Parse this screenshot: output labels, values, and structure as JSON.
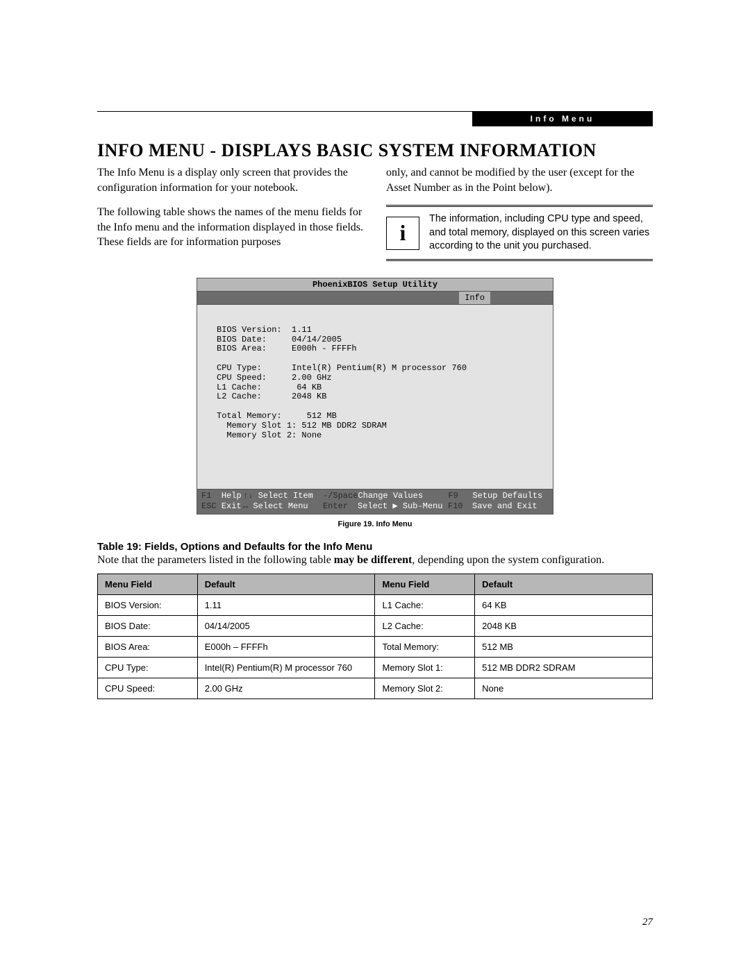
{
  "header": {
    "tab": "Info Menu"
  },
  "title": "INFO MENU - DISPLAYS BASIC SYSTEM INFORMATION",
  "body": {
    "p1": "The Info Menu is a display only screen that provides the configuration information for your notebook.",
    "p2": "The following table shows the names of the menu fields for the Info menu and the information displayed in those fields. These fields are for information purposes",
    "p3": "only, and cannot be modified by the user (except for the Asset Number as in the Point below).",
    "note": "The information, including CPU type and speed, and total memory, displayed on this screen varies according to the unit you purchased."
  },
  "bios": {
    "util_title": "PhoenixBIOS Setup Utility",
    "tab": "Info",
    "fields": [
      {
        "label": "BIOS Version:",
        "value": "1.11"
      },
      {
        "label": "BIOS Date:",
        "value": "04/14/2005"
      },
      {
        "label": "BIOS Area:",
        "value": "E000h - FFFFh"
      }
    ],
    "group2": [
      {
        "label": "CPU Type:",
        "value": "Intel(R) Pentium(R) M processor 760"
      },
      {
        "label": "CPU Speed:",
        "value": "2.00 GHz"
      },
      {
        "label": "L1 Cache:",
        "value": " 64 KB"
      },
      {
        "label": "L2 Cache:",
        "value": "2048 KB"
      }
    ],
    "group3": [
      {
        "label": "Total Memory:",
        "value": " 512 MB"
      },
      {
        "label": "  Memory Slot 1:",
        "value": "512 MB DDR2 SDRAM"
      },
      {
        "label": "  Memory Slot 2:",
        "value": "None"
      }
    ],
    "footer": {
      "r1": {
        "k1": "F1",
        "t1": "Help",
        "a1": "↑↓",
        "t2": "Select Item",
        "k2": "-/Space",
        "t3": "Change Values",
        "k3": "F9",
        "t4": "Setup Defaults"
      },
      "r2": {
        "k1": "ESC",
        "t1": "Exit",
        "a1": "↔",
        "t2": "Select Menu",
        "k2": "Enter",
        "t3": "Select ▶ Sub-Menu",
        "k3": "F10",
        "t4": "Save and Exit"
      }
    }
  },
  "caption": "Figure 19.  Info Menu",
  "table": {
    "title": "Table 19: Fields, Options and Defaults for the Info Menu",
    "note_pre": "Note that the parameters listed in the following table ",
    "note_bold": "may be different",
    "note_post": ", depending upon the system configuration.",
    "headers": {
      "h1": "Menu Field",
      "h2": "Default",
      "h3": "Menu Field",
      "h4": "Default"
    },
    "rows": [
      {
        "f1": "BIOS Version:",
        "d1": "1.11",
        "f2": "L1 Cache:",
        "d2": "64 KB"
      },
      {
        "f1": "BIOS Date:",
        "d1": "04/14/2005",
        "f2": "L2 Cache:",
        "d2": "2048 KB"
      },
      {
        "f1": "BIOS Area:",
        "d1": "E000h – FFFFh",
        "f2": "Total Memory:",
        "d2": "512 MB"
      },
      {
        "f1": "CPU Type:",
        "d1": "Intel(R) Pentium(R) M processor 760",
        "f2": "Memory Slot 1:",
        "d2": "512 MB DDR2 SDRAM"
      },
      {
        "f1": "CPU Speed:",
        "d1": "2.00 GHz",
        "f2": "Memory Slot 2:",
        "d2": "None"
      }
    ]
  },
  "page_number": "27"
}
